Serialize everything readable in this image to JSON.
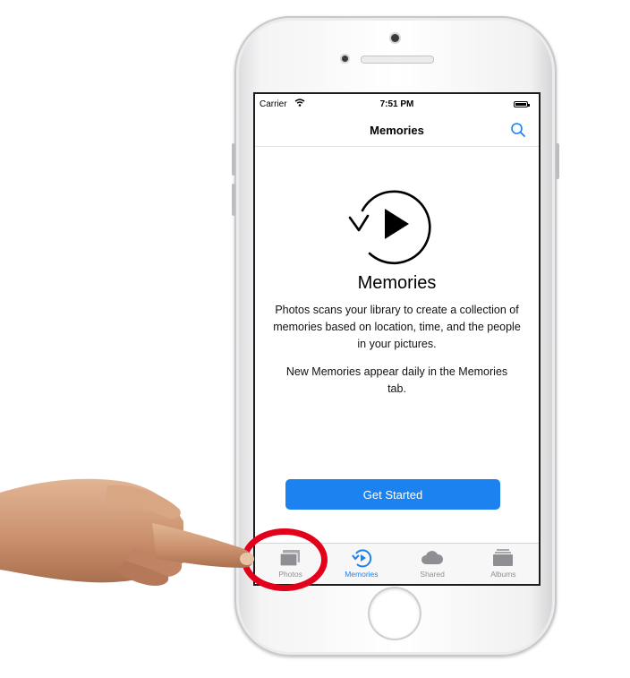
{
  "status_bar": {
    "carrier": "Carrier",
    "time": "7:51 PM",
    "battery_level": 1.0
  },
  "nav": {
    "title": "Memories",
    "search_icon": "search-icon"
  },
  "content": {
    "hero_icon": "memories-play-icon",
    "heading": "Memories",
    "description": "Photos scans your library to create a collection of memories based on location, time, and the people in your pictures.",
    "secondary": "New Memories appear daily in the Memories tab.",
    "button_label": "Get Started"
  },
  "tabs": [
    {
      "label": "Photos",
      "icon": "photos-icon",
      "active": false
    },
    {
      "label": "Memories",
      "icon": "memories-icon",
      "active": true
    },
    {
      "label": "Shared",
      "icon": "cloud-icon",
      "active": false
    },
    {
      "label": "Albums",
      "icon": "albums-icon",
      "active": false
    }
  ],
  "colors": {
    "accent": "#1c82f0",
    "highlight_ring": "#e3001b",
    "inactive_tab": "#8e8e93"
  }
}
